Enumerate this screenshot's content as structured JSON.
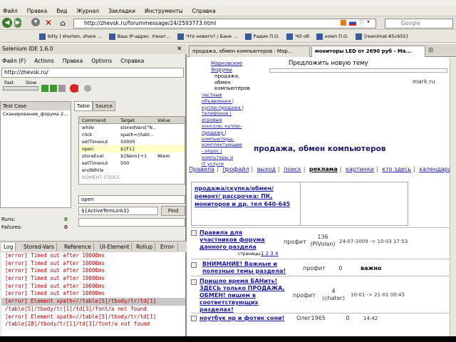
{
  "menubar": [
    "Файл",
    "Правка",
    "Вид",
    "Журнал",
    "Закладки",
    "Инструменты",
    "Справка"
  ],
  "nav": {
    "url": "http://zhevsk.ru/forummessage/24/2593773.html",
    "search_placeholder": "Google"
  },
  "bookmarks": [
    "bitly | shorten, share ...",
    "Ваш IP-адрес. Узнат...",
    "Что нового? / Банк ...",
    "Радио П.О.",
    "ЧО об",
    "комп П.О.",
    "[reanimat-65c655]"
  ],
  "selenium": {
    "title": "Selenium IDE 1.6.0",
    "menu": [
      "Файл (F)",
      "Actions",
      "Правка",
      "Options",
      "Справка"
    ],
    "base_url": "http://zhevsk.ru/",
    "speed_fast": "Fast",
    "speed_slow": "Slow",
    "testcase_header": "Test Case",
    "testcase_item": "Сканирование_форума 2...",
    "tab_table": "Table",
    "tab_source": "Source",
    "cmd_headers": [
      "Command",
      "Target",
      "Value"
    ],
    "commands": [
      [
        "while",
        "storedVars[\"N...",
        ""
      ],
      [
        "click",
        "xpath=//tabl...",
        ""
      ],
      [
        "setTimeout",
        "50000",
        ""
      ],
      [
        "open",
        "${F1}",
        ""
      ],
      [
        "storeEval",
        "${Nem}+1",
        "Ntem"
      ],
      [
        "setTimeout",
        "500",
        ""
      ],
      [
        "endWhile",
        "",
        ""
      ],
      [
        "КОМЕНТ СПОСС",
        "",
        ""
      ]
    ],
    "command_field": "open",
    "target_field": "${ActiveTemLink3}",
    "find_label": "Find",
    "runs_label": "Runs:",
    "runs_value": "0",
    "failures_label": "Failures:",
    "failures_value": "0",
    "log_tabs": [
      "Log",
      "Stored-Vars",
      "Reference",
      "UI-Element",
      "Rollup",
      "Error-"
    ],
    "log": [
      "[error] Timed out after 10000ms",
      "[error] Timed out after 10000ms",
      "[error] Timed out after 10000ms",
      "[error] Timed out after 10000ms",
      "[error] Timed out after 10000ms",
      "[error] Timed out after 10000ms",
      "[error] Element xpath=//table[5]/tbody/tr/td[1]",
      "/table[5]/tbody/tr[1]/td[3]/font/a not found",
      "[error] Element xpath=//table[5]/tbody/tr/td[1]",
      "/table[28]/tbody/tr[1]/td[3]/font/a not found"
    ]
  },
  "browser": {
    "tab1": "продажа, обмен компьютеров : Мар...",
    "tab2": "мониторы LED от 2690 руб - Ма...",
    "forum_label": [
      "Марковские",
      "Форумы"
    ],
    "forum_sub": [
      "продажа,",
      "обмен",
      "компьютеров"
    ],
    "suggest": "Предложить новую тему",
    "site": "mark.ru",
    "sidebar": [
      "частные",
      "объявления |",
      "куплю-продажа |",
      "телефонов |",
      "игровые",
      "консоли, куплю-",
      "продажу |",
      "компьютеры,",
      "комплектующие",
      "- опрос |",
      "компьтеры и",
      "IT услуги"
    ],
    "heading": "продажа, обмен компьютеров",
    "navlinks": [
      "Правила",
      "профайл",
      "выход",
      "поиск",
      "реклама",
      "картинки",
      "кто здесь",
      "календарь"
    ],
    "ad": "продажа/скупка/обмен/ ремонт/ рассрочка: ПК, мониторов и др. тел 640-645",
    "topics": [
      {
        "title": "Правила для участников форума данного раздела",
        "pages_label": "страницы:",
        "pages": "1 2 3 4",
        "author": "профит",
        "count": "136",
        "count_sub": "(PiVolan)",
        "date": "24-07-2009 -> 10-03 17:53"
      },
      {
        "title": "ВНИМАНИЕ! Важные и полезные темы раздела!",
        "author": "профит",
        "count": "0",
        "extra": "важно"
      },
      {
        "title": "Пришло время БАНить! ЗДЕСЬ только ПРОДАЖА, ОБМЕН! пишем в соответствующих разделах!",
        "author": "профит",
        "count": "4",
        "count_sub": "(chater)",
        "date": "10-01 -> 21-01 00:43"
      },
      {
        "title": "ноутбук нр и фотик сони!",
        "author": "Олег1965",
        "count": "0",
        "date": "14:42"
      }
    ]
  }
}
